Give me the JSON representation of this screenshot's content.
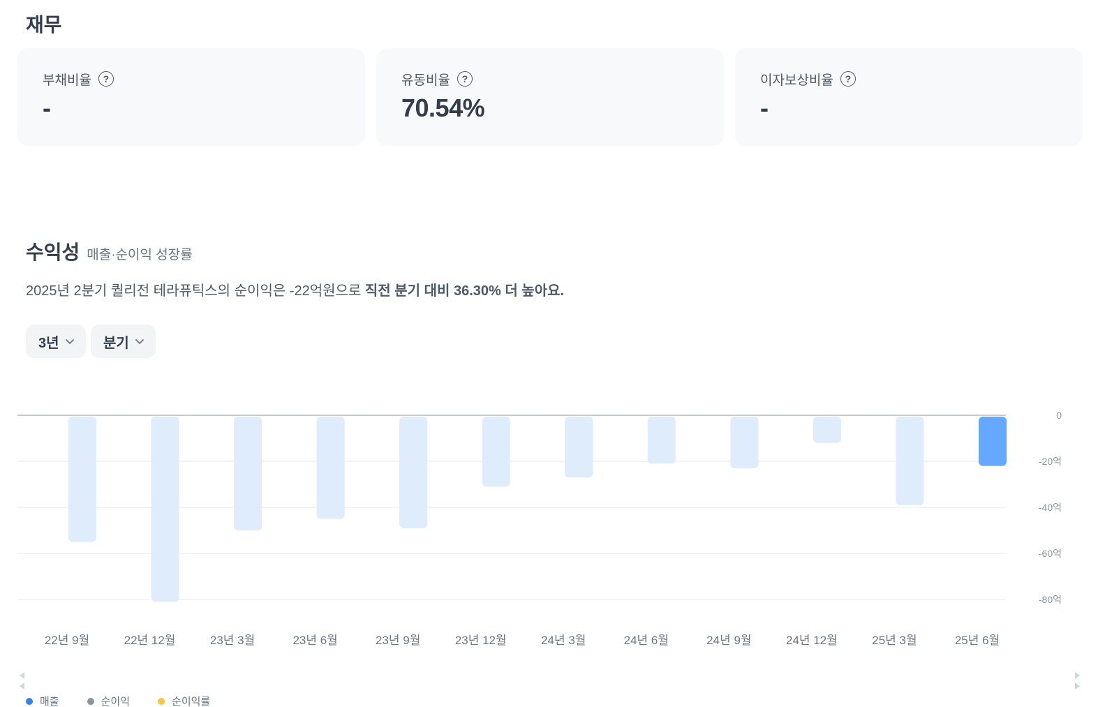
{
  "finance": {
    "title": "재무",
    "cards": [
      {
        "label": "부채비율",
        "value": "-"
      },
      {
        "label": "유동비율",
        "value": "70.54%"
      },
      {
        "label": "이자보상비율",
        "value": "-"
      }
    ]
  },
  "profitability": {
    "title": "수익성",
    "subtitle": "매출·순이익 성장률",
    "summary_prefix": "2025년 2분기 퀄리전 테라퓨틱스의 순이익은 -22억원으로 ",
    "summary_bold": "직전 분기 대비 36.30% 더 높아요.",
    "period_dropdown": "3년",
    "interval_dropdown": "분기"
  },
  "legend": [
    {
      "label": "매출",
      "color": "#3182f6"
    },
    {
      "label": "순이익",
      "color": "#8b95a1"
    },
    {
      "label": "순이익률",
      "color": "#ffc342"
    }
  ],
  "colors": {
    "bar_muted": "#dfecfc",
    "bar_active": "#64a8ff",
    "grid": "#e5e8eb",
    "zero_line": "#b0b8c1"
  },
  "chart_data": {
    "type": "bar",
    "categories": [
      "22년 9월",
      "22년 12월",
      "23년 3월",
      "23년 6월",
      "23년 9월",
      "23년 12월",
      "24년 3월",
      "24년 6월",
      "24년 9월",
      "24년 12월",
      "25년 3월",
      "25년 6월"
    ],
    "series": [
      {
        "name": "순이익",
        "values": [
          -55,
          -81,
          -50,
          -45,
          -49,
          -31,
          -27,
          -21,
          -23,
          -12,
          -39,
          -22
        ]
      }
    ],
    "highlight_index": 11,
    "yticks": [
      0,
      -20,
      -40,
      -60,
      -80
    ],
    "ytick_labels": [
      "0",
      "-20억",
      "-40억",
      "-60억",
      "-80억"
    ],
    "ylim": [
      -82,
      0
    ]
  }
}
